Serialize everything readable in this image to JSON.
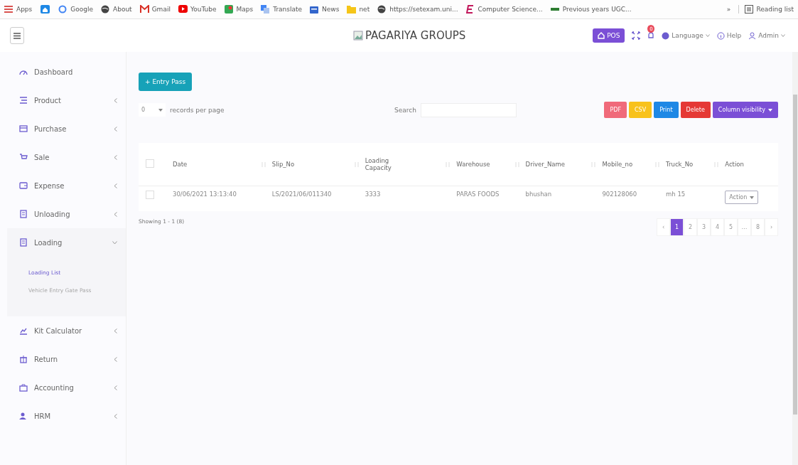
{
  "bookmarks": [
    {
      "label": "Apps",
      "kind": "link"
    },
    {
      "kind": "icon"
    },
    {
      "label": "Google",
      "kind": "link"
    },
    {
      "label": "About"
    },
    {
      "label": "Gmail"
    },
    {
      "label": "YouTube"
    },
    {
      "label": "Maps"
    },
    {
      "label": "Translate"
    },
    {
      "label": "News"
    },
    {
      "label": "net"
    },
    {
      "label": "https://setexam.uni..."
    },
    {
      "label": "Computer Science..."
    },
    {
      "label": "Previous years UGC..."
    }
  ],
  "bookmarks_more": "»",
  "reading_list": "Reading list",
  "header": {
    "brand": "PAGARIYA GROUPS",
    "pos": "POS",
    "notifications": "0",
    "language": "Language",
    "help": "Help",
    "user": "Admin"
  },
  "sidebar": {
    "items": [
      {
        "label": "Dashboard",
        "kind": "link"
      },
      {
        "label": "Product",
        "kind": "group",
        "expanded": false
      },
      {
        "label": "Purchase",
        "kind": "group",
        "expanded": false
      },
      {
        "label": "Sale",
        "kind": "group",
        "expanded": false
      },
      {
        "label": "Expense",
        "kind": "group",
        "expanded": false
      },
      {
        "label": "Unloading",
        "kind": "group",
        "expanded": false
      },
      {
        "label": "Loading",
        "kind": "group",
        "expanded": true,
        "children": [
          {
            "label": "Loading List",
            "selected": true
          },
          {
            "label": "Vehicle Entry Gate Pass",
            "selected": false
          }
        ]
      },
      {
        "label": "Kit Calculator",
        "kind": "group",
        "expanded": false
      },
      {
        "label": "Return",
        "kind": "group",
        "expanded": false
      },
      {
        "label": "Accounting",
        "kind": "group",
        "expanded": false
      },
      {
        "label": "HRM",
        "kind": "group",
        "expanded": false
      }
    ]
  },
  "entry_button": "+ Entry Pass",
  "per_page": {
    "value": "0",
    "label": "records per page"
  },
  "search": {
    "label": "Search"
  },
  "export_buttons": [
    {
      "label": "PDF",
      "color": "#f06a7a"
    },
    {
      "label": "CSV",
      "color": "#f8c21c"
    },
    {
      "label": "Print",
      "color": "#1e88e5"
    },
    {
      "label": "Delete",
      "color": "#e53935"
    }
  ],
  "column_visibility": "Column visibility",
  "table": {
    "select_all_checked": false,
    "columns": [
      "Date",
      "Slip_No",
      "Loading Capacity",
      "Warehouse",
      "Driver_Name",
      "Mobile_no",
      "Truck_No",
      "Action"
    ],
    "rows": [
      {
        "checked": false,
        "cells": [
          "30/06/2021 13:13:40",
          "LS/2021/06/011340",
          "3333",
          "PARAS FOODS",
          "bhushan",
          "902128060",
          "mh 15"
        ],
        "action": "Action"
      }
    ]
  },
  "showing": "Showing 1 - 1 (8)",
  "pagination": [
    {
      "label": "‹",
      "selected": false
    },
    {
      "label": "1",
      "selected": true
    },
    {
      "label": "2",
      "selected": false
    },
    {
      "label": "3",
      "selected": false
    },
    {
      "label": "4",
      "selected": false
    },
    {
      "label": "5",
      "selected": false
    },
    {
      "label": "…",
      "selected": false
    },
    {
      "label": "8",
      "selected": false
    },
    {
      "label": "›",
      "selected": false
    }
  ]
}
